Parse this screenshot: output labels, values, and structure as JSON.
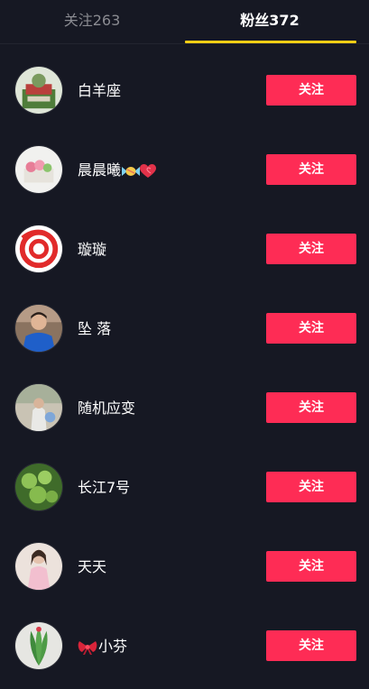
{
  "tabs": {
    "following_label": "关注263",
    "followers_label": "粉丝372",
    "active": "followers"
  },
  "colors": {
    "background": "#161823",
    "accent_button": "#fe2c55",
    "tab_indicator": "#face15",
    "inactive_tab_text": "#8a8b91"
  },
  "followers": [
    {
      "name": "白羊座",
      "button_label": "关注"
    },
    {
      "name": "晨晨曦",
      "name_suffix_icons": [
        "candy-icon",
        "heart-icon"
      ],
      "button_label": "关注"
    },
    {
      "name": "璇璇",
      "button_label": "关注"
    },
    {
      "name": "坠 落",
      "button_label": "关注"
    },
    {
      "name": "随机应变",
      "button_label": "关注"
    },
    {
      "name": "长江7号",
      "button_label": "关注"
    },
    {
      "name": "天天",
      "button_label": "关注"
    },
    {
      "name": "小芬",
      "name_prefix_icons": [
        "ribbon-icon"
      ],
      "button_label": "关注"
    }
  ]
}
